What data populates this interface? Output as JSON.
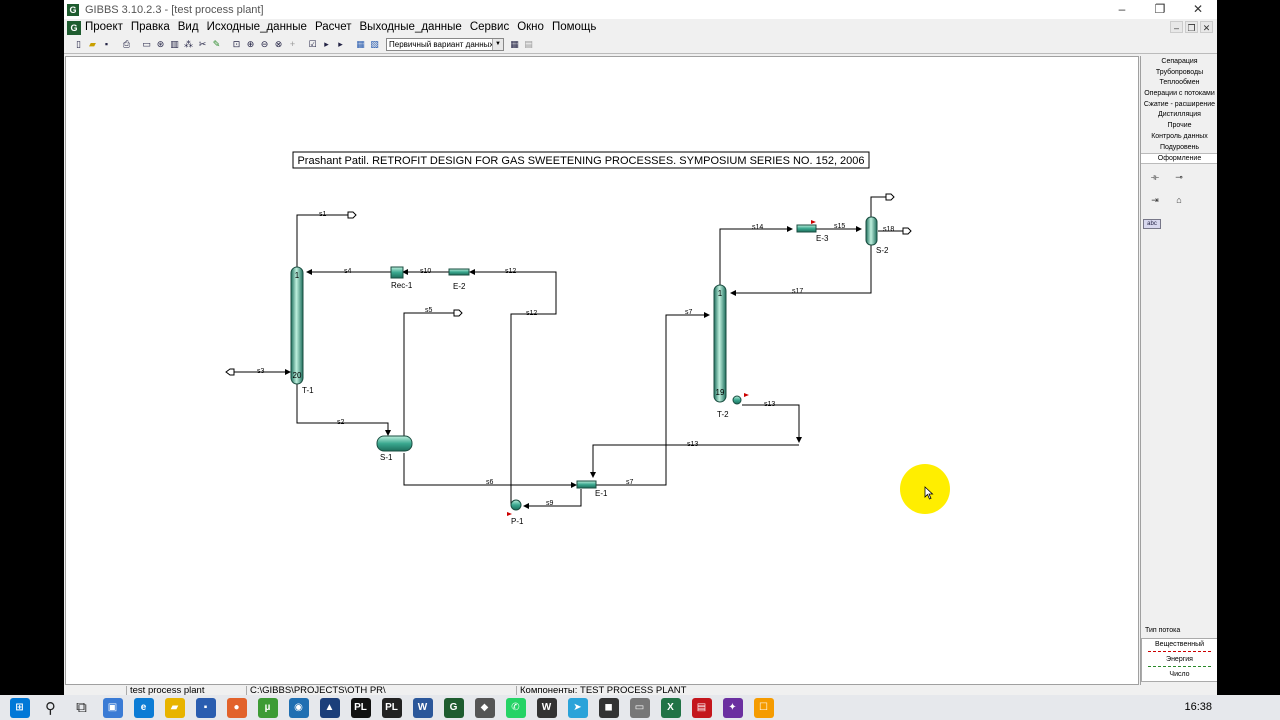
{
  "window": {
    "title": "GIBBS 3.10.2.3 - [test process plant]",
    "app_icon": "gibbs-logo-icon",
    "mdi_icon_letter": "G"
  },
  "menu": [
    "Проект",
    "Правка",
    "Вид",
    "Исходные_данные",
    "Расчет",
    "Выходные_данные",
    "Сервис",
    "Окно",
    "Помощь"
  ],
  "toolbar": {
    "dataset_select": "Первичный вариант данных"
  },
  "side_panel": {
    "categories": [
      "Сепарация",
      "Трубопроводы",
      "Теплообмен",
      "Операции с потоками",
      "Сжатие - расширение",
      "Дистилляция",
      "Прочие",
      "Контроль данных",
      "Подуровень",
      "Оформление"
    ],
    "active": "Оформление",
    "stream_type_label": "Тип потока",
    "stream_types": [
      "Вещественный",
      "Энергия",
      "Число"
    ],
    "abc_label": "abc"
  },
  "diagram": {
    "title": "Prashant Patil. RETROFIT DESIGN FOR GAS SWEETENING PROCESSES. SYMPOSIUM SERIES NO. 152, 2006",
    "units": {
      "t1": "T-1",
      "t1_top": "1",
      "t1_bottom": "20",
      "t2": "T-2",
      "t2_top": "1",
      "t2_bottom": "19",
      "s1": "S-1",
      "s2": "S-2",
      "e1": "E-1",
      "e2": "E-2",
      "e3": "E-3",
      "p1": "P-1",
      "rec1": "Rec-1"
    },
    "streams": {
      "s1": "s1",
      "s2": "s2",
      "s3": "s3",
      "s4": "s4",
      "s5": "s5",
      "s6": "s6",
      "s7a": "s7",
      "s7b": "s7",
      "s9": "s9",
      "s10": "s10",
      "s12a": "s12",
      "s12b": "s12",
      "s13a": "s13",
      "s13b": "s13",
      "s14": "s14",
      "s15": "s15",
      "s17": "s17",
      "s18": "s18"
    }
  },
  "status": {
    "project": "test process plant",
    "path": "C:\\GIBBS\\PROJECTS\\OTH PR\\",
    "components": "Компоненты: TEST PROCESS PLANT"
  },
  "taskbar": {
    "clock": "16:38",
    "apps": [
      {
        "name": "windows-start-icon",
        "glyph": "⊞",
        "color": "#0078d7"
      },
      {
        "name": "search-icon",
        "glyph": "⚲",
        "color": ""
      },
      {
        "name": "task-view-icon",
        "glyph": "⧉",
        "color": ""
      },
      {
        "name": "app-icon-1",
        "glyph": "▣",
        "color": "#3a7bd5"
      },
      {
        "name": "edge-icon",
        "glyph": "e",
        "color": "#0c7cd5"
      },
      {
        "name": "file-explorer-icon",
        "glyph": "▰",
        "color": "#e8b400"
      },
      {
        "name": "save-app-icon",
        "glyph": "▪",
        "color": "#2a5db0"
      },
      {
        "name": "firefox-icon",
        "glyph": "●",
        "color": "#e2622b"
      },
      {
        "name": "utorrent-icon",
        "glyph": "µ",
        "color": "#3d9b35"
      },
      {
        "name": "app-icon-2",
        "glyph": "◉",
        "color": "#1f6fb2"
      },
      {
        "name": "virtualbox-icon",
        "glyph": "▲",
        "color": "#1b3f7a"
      },
      {
        "name": "pl-app-icon",
        "glyph": "PL",
        "color": "#111"
      },
      {
        "name": "pl-app-icon-2",
        "glyph": "PL",
        "color": "#222"
      },
      {
        "name": "word-icon",
        "glyph": "W",
        "color": "#2b579a"
      },
      {
        "name": "gibbs-taskbar-icon",
        "glyph": "G",
        "color": "#1e5c2f"
      },
      {
        "name": "app-icon-3",
        "glyph": "◆",
        "color": "#555"
      },
      {
        "name": "whatsapp-icon",
        "glyph": "✆",
        "color": "#25d366"
      },
      {
        "name": "app-icon-4",
        "glyph": "W",
        "color": "#333"
      },
      {
        "name": "telegram-icon",
        "glyph": "➤",
        "color": "#2aa3d9"
      },
      {
        "name": "app-icon-5",
        "glyph": "◼",
        "color": "#333"
      },
      {
        "name": "app-icon-6",
        "glyph": "▭",
        "color": "#777"
      },
      {
        "name": "excel-icon",
        "glyph": "X",
        "color": "#217346"
      },
      {
        "name": "pdf-icon",
        "glyph": "▤",
        "color": "#c4161c"
      },
      {
        "name": "app-icon-7",
        "glyph": "✦",
        "color": "#6b2fa0"
      },
      {
        "name": "app-icon-8",
        "glyph": "☐",
        "color": "#f59b00"
      }
    ]
  },
  "colors": {
    "equipment": "#3aa88f",
    "equipment_dark": "#1d6e5c",
    "material_stream": "#000000",
    "energy_stream": "#cc0000",
    "cursor_halo": "#ffee00"
  }
}
